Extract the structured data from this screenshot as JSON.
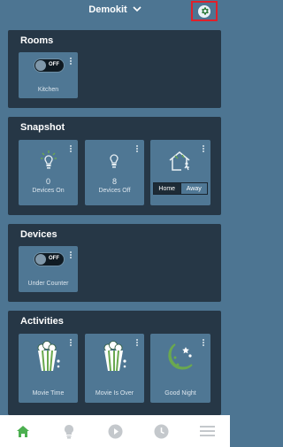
{
  "header": {
    "title": "Demokit"
  },
  "rooms": {
    "title": "Rooms",
    "tiles": [
      {
        "name": "Kitchen",
        "toggle_state": "OFF"
      }
    ]
  },
  "snapshot": {
    "title": "Snapshot",
    "devices_on": {
      "count": "0",
      "label": "Devices On"
    },
    "devices_off": {
      "count": "8",
      "label": "Devices Off"
    },
    "mode": {
      "options": [
        "Home",
        "Away"
      ],
      "selected": "Home"
    }
  },
  "devices": {
    "title": "Devices",
    "tiles": [
      {
        "name": "Under Counter",
        "toggle_state": "OFF"
      }
    ]
  },
  "activities": {
    "title": "Activities",
    "tiles": [
      {
        "name": "Movie Time",
        "icon": "popcorn-icon"
      },
      {
        "name": "Movie Is Over",
        "icon": "popcorn-icon"
      },
      {
        "name": "Good Night",
        "icon": "moon-stars-icon"
      }
    ]
  },
  "nav": {
    "items": [
      {
        "icon": "home-icon",
        "active": true
      },
      {
        "icon": "lightbulb-icon",
        "active": false
      },
      {
        "icon": "play-icon",
        "active": false
      },
      {
        "icon": "clock-icon",
        "active": false
      },
      {
        "icon": "menu-icon",
        "active": false
      }
    ]
  },
  "colors": {
    "accent": "#6aa84f",
    "panel": "#263746",
    "tile": "#4f7794",
    "background": "#4d7592",
    "highlight": "#e0202a"
  }
}
